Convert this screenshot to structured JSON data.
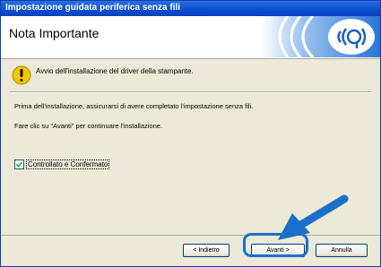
{
  "window": {
    "title": "Impostazione guidata periferica senza fili"
  },
  "header": {
    "title": "Nota Importante"
  },
  "content": {
    "warning_text": "Avvio dell'installazione del driver della stampante.",
    "line1": "Prima dell'installazione, assicurarsi di avere completato l'impostazione senza fili.",
    "line2": "Fare clic su \"Avanti\" per continuare l'installazione.",
    "checkbox_label": "Controllato e Confermato",
    "checkbox_checked": true
  },
  "buttons": {
    "back": "< Indietro",
    "next": "Avanti >",
    "cancel": "Annulla"
  },
  "icons": {
    "warning": "warning-icon",
    "wireless": "wireless-logo-icon",
    "arrow": "pointer-arrow-icon"
  },
  "colors": {
    "title_bar": "#0a4fd0",
    "highlight": "#1b6fc8",
    "warning": "#f5c400"
  }
}
